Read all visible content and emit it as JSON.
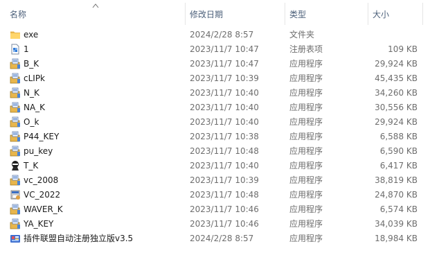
{
  "columns": {
    "name": "名称",
    "date": "修改日期",
    "type": "类型",
    "size": "大小"
  },
  "files": [
    {
      "name": "exe",
      "date": "2024/2/28 8:57",
      "type": "文件夹",
      "size": "",
      "icon": "folder-icon"
    },
    {
      "name": "1",
      "date": "2023/11/7 10:47",
      "type": "注册表项",
      "size": "109 KB",
      "icon": "registry-file-icon"
    },
    {
      "name": "B_K",
      "date": "2023/11/7 10:47",
      "type": "应用程序",
      "size": "29,924 KB",
      "icon": "installer-icon"
    },
    {
      "name": "cLIPk",
      "date": "2023/11/7 10:39",
      "type": "应用程序",
      "size": "45,435 KB",
      "icon": "installer-icon"
    },
    {
      "name": "N_K",
      "date": "2023/11/7 10:40",
      "type": "应用程序",
      "size": "34,260 KB",
      "icon": "installer-icon"
    },
    {
      "name": "NA_K",
      "date": "2023/11/7 10:40",
      "type": "应用程序",
      "size": "30,556 KB",
      "icon": "installer-icon"
    },
    {
      "name": "O_k",
      "date": "2023/11/7 10:40",
      "type": "应用程序",
      "size": "29,924 KB",
      "icon": "installer-icon"
    },
    {
      "name": "P44_KEY",
      "date": "2023/11/7 10:38",
      "type": "应用程序",
      "size": "6,588 KB",
      "icon": "installer-icon"
    },
    {
      "name": "pu_key",
      "date": "2023/11/7 10:48",
      "type": "应用程序",
      "size": "6,590 KB",
      "icon": "installer-icon"
    },
    {
      "name": "T_K",
      "date": "2023/11/7 10:40",
      "type": "应用程序",
      "size": "6,417 KB",
      "icon": "ninja-app-icon"
    },
    {
      "name": "vc_2008",
      "date": "2023/11/7 10:39",
      "type": "应用程序",
      "size": "38,819 KB",
      "icon": "installer-icon"
    },
    {
      "name": "VC_2022",
      "date": "2023/11/7 10:48",
      "type": "应用程序",
      "size": "24,870 KB",
      "icon": "setup-app-icon"
    },
    {
      "name": "WAVER_K",
      "date": "2023/11/7 10:46",
      "type": "应用程序",
      "size": "6,574 KB",
      "icon": "installer-icon"
    },
    {
      "name": "YA_KEY",
      "date": "2023/11/7 10:46",
      "type": "应用程序",
      "size": "34,039 KB",
      "icon": "installer-icon"
    },
    {
      "name": "插件联盟自动注册独立版v3.5",
      "date": "2024/2/28 8:57",
      "type": "应用程序",
      "size": "18,984 KB",
      "icon": "plugin-app-icon"
    }
  ]
}
